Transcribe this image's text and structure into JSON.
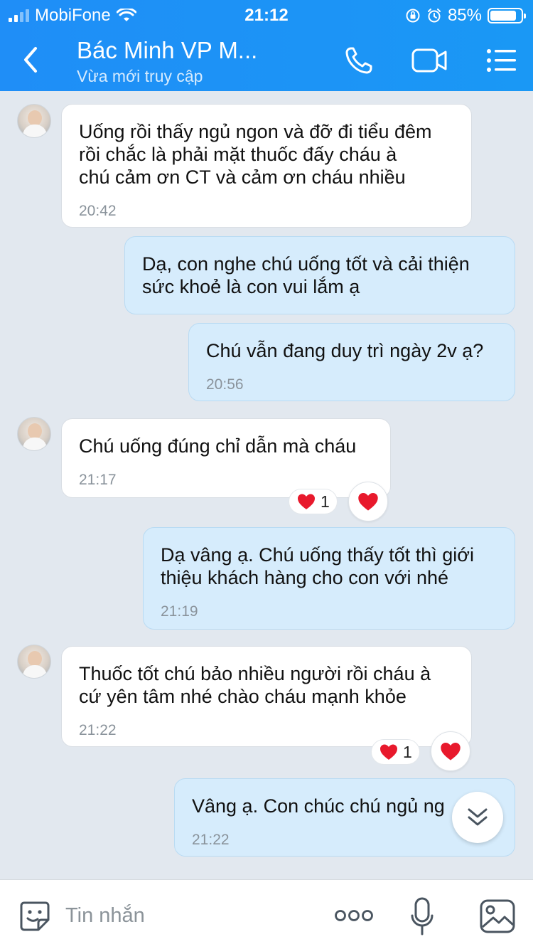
{
  "status_bar": {
    "carrier": "MobiFone",
    "time": "21:12",
    "battery": "85%",
    "battery_level": 0.85
  },
  "header": {
    "title": "Bác Minh VP M...",
    "subtitle": "Vừa mới truy cập",
    "icons": [
      "back-icon",
      "phone-icon",
      "video-icon",
      "menu-icon"
    ]
  },
  "messages": [
    {
      "direction": "in",
      "text": "Uống rồi thấy ngủ ngon và đỡ đi tiểu đêm\nrồi chắc là phải mặt thuốc đấy cháu à\nchú cảm ơn CT và cảm ơn cháu nhiều",
      "time": "20:42"
    },
    {
      "direction": "out",
      "text": "Dạ, con nghe chú uống tốt và cải thiện\nsức khoẻ là con vui lắm ạ",
      "time": ""
    },
    {
      "direction": "out",
      "text": "Chú vẫn đang duy trì ngày 2v ạ?",
      "time": "20:56"
    },
    {
      "direction": "in",
      "text": "Chú uống đúng chỉ dẫn mà cháu",
      "time": "21:17",
      "reaction_count": "1"
    },
    {
      "direction": "out",
      "text": "Dạ vâng ạ. Chú uống thấy tốt thì giới\nthiệu khách hàng cho con với nhé",
      "time": "21:19"
    },
    {
      "direction": "in",
      "text": "Thuốc tốt chú bảo nhiều người rồi cháu à\ncứ yên tâm nhé chào cháu mạnh khỏe",
      "time": "21:22",
      "reaction_count": "1"
    },
    {
      "direction": "out",
      "text": "Vâng ạ. Con chúc chú ngủ ng",
      "time": "21:22"
    }
  ],
  "input": {
    "placeholder": "Tin nhắn"
  },
  "colors": {
    "header": "#1f8ef7",
    "chat_bg": "#e2e8ef",
    "incoming_bubble": "#ffffff",
    "outgoing_bubble": "#d6ecfc",
    "heart": "#e8192c"
  }
}
